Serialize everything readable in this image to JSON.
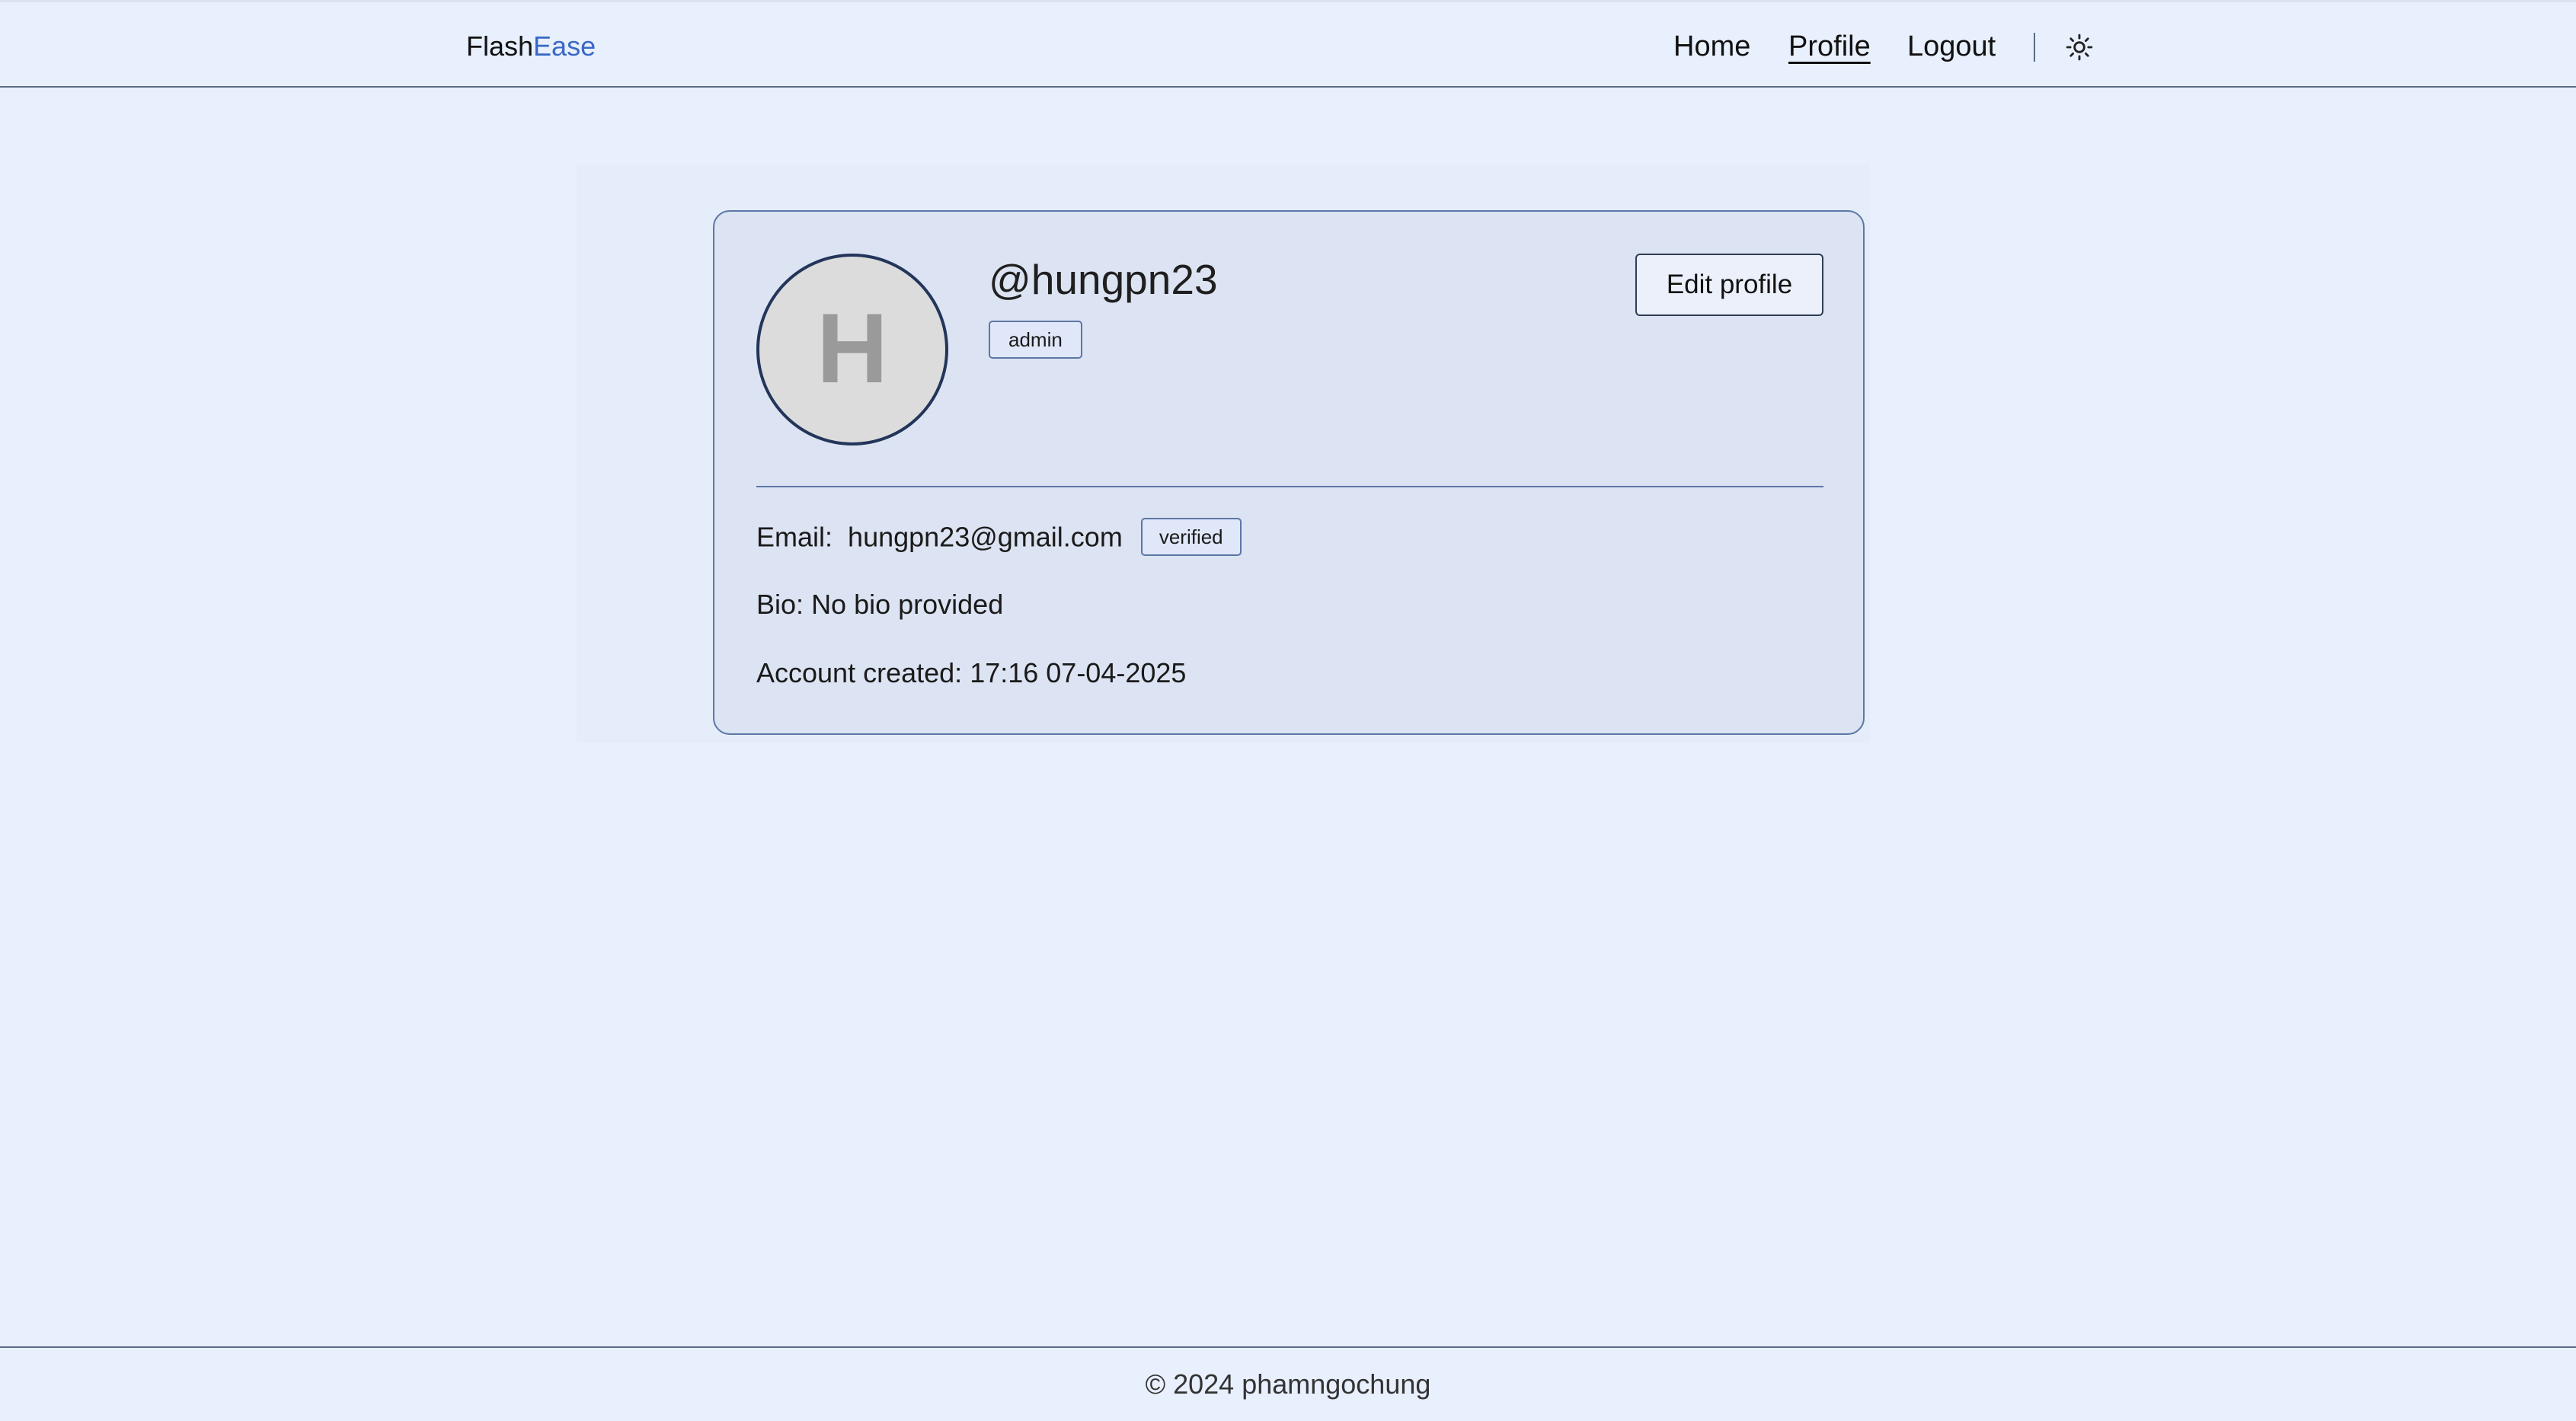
{
  "header": {
    "brand_part1": "Flash",
    "brand_part2": "Ease",
    "nav": {
      "home": "Home",
      "profile": "Profile",
      "logout": "Logout"
    },
    "theme_toggle_icon": "sun-icon"
  },
  "profile": {
    "avatar_initial": "H",
    "username": "@hungpn23",
    "role": "admin",
    "edit_button": "Edit profile",
    "email_label": "Email:",
    "email": "hungpn23@gmail.com",
    "email_status": "verified",
    "bio_label": "Bio:",
    "bio": "No bio provided",
    "created_label": "Account created:",
    "created": "17:16 07-04-2025"
  },
  "footer": {
    "copyright": "© 2024 phamngochung"
  },
  "colors": {
    "background": "#e8effd",
    "card": "#dce3f2",
    "accent": "#3a68c4",
    "border": "#5c77a6"
  }
}
